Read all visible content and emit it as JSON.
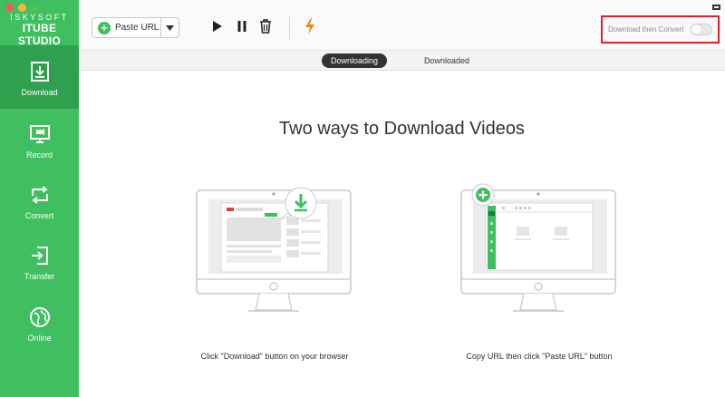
{
  "app": {
    "brand_top": "ISKYSOFT",
    "brand_bottom": "ITUBE STUDIO"
  },
  "sidebar": {
    "items": [
      {
        "label": "Download",
        "icon": "download-icon",
        "active": true
      },
      {
        "label": "Record",
        "icon": "record-icon",
        "active": false
      },
      {
        "label": "Convert",
        "icon": "convert-icon",
        "active": false
      },
      {
        "label": "Transfer",
        "icon": "transfer-icon",
        "active": false
      },
      {
        "label": "Online",
        "icon": "online-icon",
        "active": false
      }
    ]
  },
  "toolbar": {
    "paste_url_label": "Paste URL",
    "download_then_convert_label": "Download then Convert",
    "download_then_convert_on": false
  },
  "tabs": [
    {
      "label": "Downloading",
      "active": true
    },
    {
      "label": "Downloaded",
      "active": false
    }
  ],
  "main": {
    "title": "Two ways to Download Videos",
    "captions": [
      "Click \"Download\" button on your browser",
      "Copy URL then click \"Paste URL\" button"
    ]
  },
  "colors": {
    "sidebar_green": "#3fbf5f",
    "sidebar_active": "#2ea04e",
    "highlight_red": "#e0202a"
  }
}
